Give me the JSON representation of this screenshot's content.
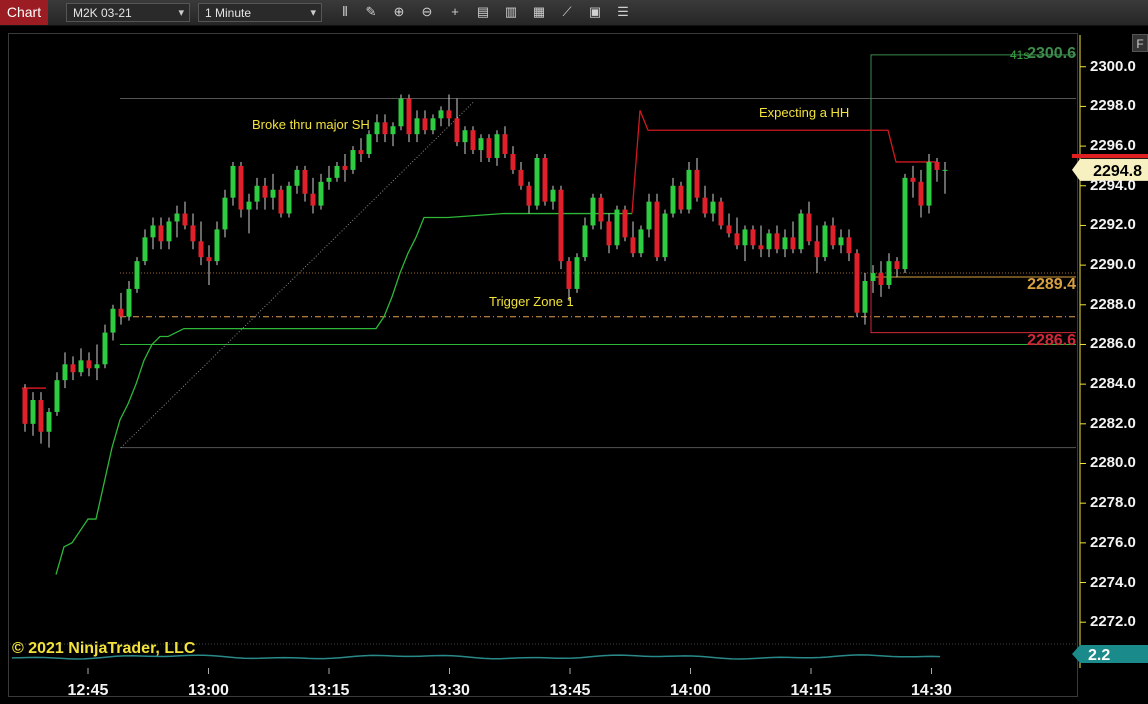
{
  "toolbar": {
    "tab_label": "Chart",
    "instrument": "M2K 03-21",
    "interval": "1 Minute",
    "icons": [
      "bar-type-icon",
      "draw-pencil-icon",
      "zoom-in-icon",
      "zoom-out-icon",
      "crosshair-icon",
      "data-box-icon",
      "indicators-icon",
      "strategies-icon",
      "drawing-tools-icon",
      "chart-properties-icon",
      "more-icon"
    ]
  },
  "right_button": "F",
  "countdown": "41s",
  "annotations": {
    "broke": "Broke thru major SH",
    "expecting": "Expecting a HH",
    "trigger": "Trigger Zone 1"
  },
  "copyright": "© 2021 NinjaTrader, LLC",
  "price_axis": {
    "labels": [
      "2300.0",
      "2298.0",
      "2296.0",
      "2294.0",
      "2292.0",
      "2290.0",
      "2288.0",
      "2286.0",
      "2284.0",
      "2282.0",
      "2280.0",
      "2278.0",
      "2276.0",
      "2274.0",
      "2272.0"
    ],
    "current_price": "2294.8",
    "badges": {
      "high": "2300.6",
      "mid": "2289.4",
      "low": "2286.6"
    },
    "indicator_value": "2.2"
  },
  "time_axis": [
    "12:45",
    "13:00",
    "13:15",
    "13:30",
    "13:45",
    "14:00",
    "14:15",
    "14:30"
  ],
  "colors": {
    "up": "#2ecc40",
    "down": "#e0202a",
    "stop_line": "#d01820",
    "trail_line": "#2db83a",
    "high_badge": "#3c8c4c",
    "mid_badge": "#d8a040",
    "low_badge": "#d02838",
    "axis": "#f4f4f4"
  },
  "chart_data": {
    "type": "candlestick",
    "ylim": [
      2270.8,
      2301.6
    ],
    "x_start_minutes": 0,
    "minutes_per_tick": 15,
    "time_ticks": [
      0,
      15,
      30,
      45,
      60,
      75,
      90,
      105
    ],
    "candles": [
      {
        "o": 2283.8,
        "h": 2284.0,
        "l": 2281.6,
        "c": 2282.0
      },
      {
        "o": 2282.0,
        "h": 2283.6,
        "l": 2281.4,
        "c": 2283.2
      },
      {
        "o": 2283.2,
        "h": 2283.6,
        "l": 2281.0,
        "c": 2281.6
      },
      {
        "o": 2281.6,
        "h": 2282.8,
        "l": 2280.8,
        "c": 2282.6
      },
      {
        "o": 2282.6,
        "h": 2284.6,
        "l": 2282.4,
        "c": 2284.2
      },
      {
        "o": 2284.2,
        "h": 2285.6,
        "l": 2283.8,
        "c": 2285.0
      },
      {
        "o": 2285.0,
        "h": 2285.4,
        "l": 2284.2,
        "c": 2284.6
      },
      {
        "o": 2284.6,
        "h": 2285.8,
        "l": 2284.4,
        "c": 2285.2
      },
      {
        "o": 2285.2,
        "h": 2285.6,
        "l": 2284.4,
        "c": 2284.8
      },
      {
        "o": 2284.8,
        "h": 2286.0,
        "l": 2284.2,
        "c": 2285.0
      },
      {
        "o": 2285.0,
        "h": 2287.0,
        "l": 2284.8,
        "c": 2286.6
      },
      {
        "o": 2286.6,
        "h": 2288.0,
        "l": 2286.2,
        "c": 2287.8
      },
      {
        "o": 2287.8,
        "h": 2288.6,
        "l": 2287.0,
        "c": 2287.4
      },
      {
        "o": 2287.4,
        "h": 2289.2,
        "l": 2287.2,
        "c": 2288.8
      },
      {
        "o": 2288.8,
        "h": 2290.4,
        "l": 2288.6,
        "c": 2290.2
      },
      {
        "o": 2290.2,
        "h": 2291.8,
        "l": 2290.0,
        "c": 2291.4
      },
      {
        "o": 2291.4,
        "h": 2292.4,
        "l": 2290.8,
        "c": 2292.0
      },
      {
        "o": 2292.0,
        "h": 2292.4,
        "l": 2290.8,
        "c": 2291.2
      },
      {
        "o": 2291.2,
        "h": 2292.4,
        "l": 2290.8,
        "c": 2292.2
      },
      {
        "o": 2292.2,
        "h": 2293.0,
        "l": 2291.4,
        "c": 2292.6
      },
      {
        "o": 2292.6,
        "h": 2293.2,
        "l": 2291.8,
        "c": 2292.0
      },
      {
        "o": 2292.0,
        "h": 2292.6,
        "l": 2290.8,
        "c": 2291.2
      },
      {
        "o": 2291.2,
        "h": 2292.2,
        "l": 2290.0,
        "c": 2290.4
      },
      {
        "o": 2290.4,
        "h": 2291.0,
        "l": 2289.0,
        "c": 2290.2
      },
      {
        "o": 2290.2,
        "h": 2292.2,
        "l": 2290.0,
        "c": 2291.8
      },
      {
        "o": 2291.8,
        "h": 2293.8,
        "l": 2291.4,
        "c": 2293.4
      },
      {
        "o": 2293.4,
        "h": 2295.2,
        "l": 2293.0,
        "c": 2295.0
      },
      {
        "o": 2295.0,
        "h": 2295.2,
        "l": 2292.4,
        "c": 2292.8
      },
      {
        "o": 2292.8,
        "h": 2293.6,
        "l": 2291.6,
        "c": 2293.2
      },
      {
        "o": 2293.2,
        "h": 2294.4,
        "l": 2292.8,
        "c": 2294.0
      },
      {
        "o": 2294.0,
        "h": 2294.4,
        "l": 2292.8,
        "c": 2293.4
      },
      {
        "o": 2293.4,
        "h": 2294.6,
        "l": 2292.8,
        "c": 2293.8
      },
      {
        "o": 2293.8,
        "h": 2294.0,
        "l": 2292.4,
        "c": 2292.6
      },
      {
        "o": 2292.6,
        "h": 2294.2,
        "l": 2292.4,
        "c": 2294.0
      },
      {
        "o": 2294.0,
        "h": 2295.0,
        "l": 2293.6,
        "c": 2294.8
      },
      {
        "o": 2294.8,
        "h": 2295.0,
        "l": 2293.2,
        "c": 2293.6
      },
      {
        "o": 2293.6,
        "h": 2294.4,
        "l": 2292.6,
        "c": 2293.0
      },
      {
        "o": 2293.0,
        "h": 2294.6,
        "l": 2292.8,
        "c": 2294.2
      },
      {
        "o": 2294.2,
        "h": 2295.0,
        "l": 2293.8,
        "c": 2294.4
      },
      {
        "o": 2294.4,
        "h": 2295.2,
        "l": 2294.2,
        "c": 2295.0
      },
      {
        "o": 2295.0,
        "h": 2295.6,
        "l": 2294.2,
        "c": 2294.8
      },
      {
        "o": 2294.8,
        "h": 2296.0,
        "l": 2294.6,
        "c": 2295.8
      },
      {
        "o": 2295.8,
        "h": 2296.4,
        "l": 2295.2,
        "c": 2295.6
      },
      {
        "o": 2295.6,
        "h": 2296.8,
        "l": 2295.4,
        "c": 2296.6
      },
      {
        "o": 2296.6,
        "h": 2297.6,
        "l": 2296.2,
        "c": 2297.2
      },
      {
        "o": 2297.2,
        "h": 2297.6,
        "l": 2296.2,
        "c": 2296.6
      },
      {
        "o": 2296.6,
        "h": 2297.2,
        "l": 2296.0,
        "c": 2297.0
      },
      {
        "o": 2297.0,
        "h": 2298.6,
        "l": 2296.8,
        "c": 2298.4
      },
      {
        "o": 2298.4,
        "h": 2298.6,
        "l": 2296.2,
        "c": 2296.6
      },
      {
        "o": 2296.6,
        "h": 2297.8,
        "l": 2296.2,
        "c": 2297.4
      },
      {
        "o": 2297.4,
        "h": 2297.8,
        "l": 2296.6,
        "c": 2296.8
      },
      {
        "o": 2296.8,
        "h": 2297.6,
        "l": 2296.6,
        "c": 2297.4
      },
      {
        "o": 2297.4,
        "h": 2298.0,
        "l": 2297.0,
        "c": 2297.8
      },
      {
        "o": 2297.8,
        "h": 2298.6,
        "l": 2297.0,
        "c": 2297.4
      },
      {
        "o": 2297.4,
        "h": 2298.4,
        "l": 2296.0,
        "c": 2296.2
      },
      {
        "o": 2296.2,
        "h": 2297.0,
        "l": 2295.6,
        "c": 2296.8
      },
      {
        "o": 2296.8,
        "h": 2297.0,
        "l": 2295.6,
        "c": 2295.8
      },
      {
        "o": 2295.8,
        "h": 2296.6,
        "l": 2295.2,
        "c": 2296.4
      },
      {
        "o": 2296.4,
        "h": 2296.6,
        "l": 2295.2,
        "c": 2295.4
      },
      {
        "o": 2295.4,
        "h": 2296.8,
        "l": 2295.0,
        "c": 2296.6
      },
      {
        "o": 2296.6,
        "h": 2297.0,
        "l": 2295.4,
        "c": 2295.6
      },
      {
        "o": 2295.6,
        "h": 2296.0,
        "l": 2294.6,
        "c": 2294.8
      },
      {
        "o": 2294.8,
        "h": 2295.2,
        "l": 2293.8,
        "c": 2294.0
      },
      {
        "o": 2294.0,
        "h": 2294.2,
        "l": 2292.6,
        "c": 2293.0
      },
      {
        "o": 2293.0,
        "h": 2295.6,
        "l": 2292.8,
        "c": 2295.4
      },
      {
        "o": 2295.4,
        "h": 2295.6,
        "l": 2293.0,
        "c": 2293.2
      },
      {
        "o": 2293.2,
        "h": 2294.0,
        "l": 2292.8,
        "c": 2293.8
      },
      {
        "o": 2293.8,
        "h": 2294.0,
        "l": 2289.8,
        "c": 2290.2
      },
      {
        "o": 2290.2,
        "h": 2290.4,
        "l": 2288.2,
        "c": 2288.8
      },
      {
        "o": 2288.8,
        "h": 2290.6,
        "l": 2288.6,
        "c": 2290.4
      },
      {
        "o": 2290.4,
        "h": 2292.4,
        "l": 2290.2,
        "c": 2292.0
      },
      {
        "o": 2292.0,
        "h": 2293.6,
        "l": 2291.8,
        "c": 2293.4
      },
      {
        "o": 2293.4,
        "h": 2293.6,
        "l": 2291.8,
        "c": 2292.2
      },
      {
        "o": 2292.2,
        "h": 2292.6,
        "l": 2290.6,
        "c": 2291.0
      },
      {
        "o": 2291.0,
        "h": 2293.0,
        "l": 2290.8,
        "c": 2292.8
      },
      {
        "o": 2292.8,
        "h": 2293.0,
        "l": 2291.2,
        "c": 2291.4
      },
      {
        "o": 2291.4,
        "h": 2292.2,
        "l": 2290.4,
        "c": 2290.6
      },
      {
        "o": 2290.6,
        "h": 2292.0,
        "l": 2290.4,
        "c": 2291.8
      },
      {
        "o": 2291.8,
        "h": 2293.6,
        "l": 2291.4,
        "c": 2293.2
      },
      {
        "o": 2293.2,
        "h": 2293.6,
        "l": 2290.2,
        "c": 2290.4
      },
      {
        "o": 2290.4,
        "h": 2292.8,
        "l": 2290.2,
        "c": 2292.6
      },
      {
        "o": 2292.6,
        "h": 2294.4,
        "l": 2292.4,
        "c": 2294.0
      },
      {
        "o": 2294.0,
        "h": 2294.2,
        "l": 2292.6,
        "c": 2292.8
      },
      {
        "o": 2292.8,
        "h": 2295.2,
        "l": 2292.6,
        "c": 2294.8
      },
      {
        "o": 2294.8,
        "h": 2295.4,
        "l": 2293.2,
        "c": 2293.4
      },
      {
        "o": 2293.4,
        "h": 2294.0,
        "l": 2292.4,
        "c": 2292.6
      },
      {
        "o": 2292.6,
        "h": 2293.6,
        "l": 2292.2,
        "c": 2293.2
      },
      {
        "o": 2293.2,
        "h": 2293.4,
        "l": 2291.8,
        "c": 2292.0
      },
      {
        "o": 2292.0,
        "h": 2292.6,
        "l": 2291.4,
        "c": 2291.6
      },
      {
        "o": 2291.6,
        "h": 2292.4,
        "l": 2290.8,
        "c": 2291.0
      },
      {
        "o": 2291.0,
        "h": 2292.0,
        "l": 2290.2,
        "c": 2291.8
      },
      {
        "o": 2291.8,
        "h": 2292.0,
        "l": 2290.8,
        "c": 2291.0
      },
      {
        "o": 2291.0,
        "h": 2292.0,
        "l": 2290.4,
        "c": 2290.8
      },
      {
        "o": 2290.8,
        "h": 2291.8,
        "l": 2290.4,
        "c": 2291.6
      },
      {
        "o": 2291.6,
        "h": 2292.0,
        "l": 2290.6,
        "c": 2290.8
      },
      {
        "o": 2290.8,
        "h": 2291.8,
        "l": 2290.4,
        "c": 2291.4
      },
      {
        "o": 2291.4,
        "h": 2292.2,
        "l": 2290.6,
        "c": 2290.8
      },
      {
        "o": 2290.8,
        "h": 2292.8,
        "l": 2290.6,
        "c": 2292.6
      },
      {
        "o": 2292.6,
        "h": 2293.2,
        "l": 2291.0,
        "c": 2291.2
      },
      {
        "o": 2291.2,
        "h": 2292.0,
        "l": 2289.6,
        "c": 2290.4
      },
      {
        "o": 2290.4,
        "h": 2292.2,
        "l": 2290.2,
        "c": 2292.0
      },
      {
        "o": 2292.0,
        "h": 2292.4,
        "l": 2290.8,
        "c": 2291.0
      },
      {
        "o": 2291.0,
        "h": 2291.8,
        "l": 2290.6,
        "c": 2291.4
      },
      {
        "o": 2291.4,
        "h": 2291.8,
        "l": 2290.2,
        "c": 2290.6
      },
      {
        "o": 2290.6,
        "h": 2290.8,
        "l": 2287.4,
        "c": 2287.6
      },
      {
        "o": 2287.6,
        "h": 2289.6,
        "l": 2287.0,
        "c": 2289.2
      },
      {
        "o": 2289.2,
        "h": 2290.0,
        "l": 2288.6,
        "c": 2289.6
      },
      {
        "o": 2289.6,
        "h": 2290.2,
        "l": 2288.4,
        "c": 2289.0
      },
      {
        "o": 2289.0,
        "h": 2290.6,
        "l": 2288.8,
        "c": 2290.2
      },
      {
        "o": 2290.2,
        "h": 2290.4,
        "l": 2289.4,
        "c": 2289.8
      },
      {
        "o": 2289.8,
        "h": 2294.6,
        "l": 2289.6,
        "c": 2294.4
      },
      {
        "o": 2294.4,
        "h": 2295.0,
        "l": 2293.4,
        "c": 2294.2
      },
      {
        "o": 2294.2,
        "h": 2294.8,
        "l": 2292.4,
        "c": 2293.0
      },
      {
        "o": 2293.0,
        "h": 2295.6,
        "l": 2292.6,
        "c": 2295.2
      },
      {
        "o": 2295.2,
        "h": 2295.4,
        "l": 2294.2,
        "c": 2294.8
      },
      {
        "o": 2294.8,
        "h": 2295.2,
        "l": 2293.6,
        "c": 2294.8
      }
    ],
    "trail_line": [
      [
        0,
        2274.4
      ],
      [
        1,
        2275.8
      ],
      [
        2,
        2276.0
      ],
      [
        3,
        2276.6
      ],
      [
        4,
        2277.2
      ],
      [
        5,
        2277.2
      ],
      [
        6,
        2279.0
      ],
      [
        7,
        2280.8
      ],
      [
        8,
        2282.2
      ],
      [
        9,
        2283.0
      ],
      [
        10,
        2284.0
      ],
      [
        11,
        2285.2
      ],
      [
        12,
        2286.0
      ],
      [
        13,
        2286.4
      ],
      [
        14,
        2286.4
      ],
      [
        15,
        2286.6
      ],
      [
        16,
        2286.8
      ],
      [
        20,
        2286.8
      ],
      [
        24,
        2286.8
      ],
      [
        30,
        2286.8
      ],
      [
        36,
        2286.8
      ],
      [
        40,
        2286.8
      ],
      [
        41,
        2287.4
      ],
      [
        42,
        2288.4
      ],
      [
        43,
        2289.6
      ],
      [
        44,
        2290.6
      ],
      [
        45,
        2291.4
      ],
      [
        46,
        2292.4
      ],
      [
        47,
        2292.4
      ],
      [
        48,
        2292.4
      ],
      [
        49,
        2292.4
      ],
      [
        56,
        2292.6
      ],
      [
        64,
        2292.6
      ],
      [
        72,
        2292.6
      ]
    ],
    "stop_line": [
      [
        72,
        2292.6
      ],
      [
        73,
        2297.8
      ],
      [
        74,
        2296.8
      ],
      [
        82,
        2296.8
      ],
      [
        95,
        2296.8
      ],
      [
        104,
        2296.8
      ],
      [
        105,
        2295.2
      ],
      [
        110,
        2295.2
      ]
    ],
    "level_lines": {
      "upper_gray": 2298.4,
      "zone_upper": 2289.6,
      "trigger_dashdot": 2287.4,
      "lower_green": 2286.0,
      "lower_gray": 2280.8
    },
    "trend_line": [
      [
        0,
        2280.8
      ],
      [
        41,
        2298.2
      ]
    ],
    "position_box": {
      "high": 2300.6,
      "mid": 2289.4,
      "low": 2286.6,
      "from_minute": 106
    },
    "indicator": {
      "name": "volume",
      "last": 2.2
    }
  }
}
